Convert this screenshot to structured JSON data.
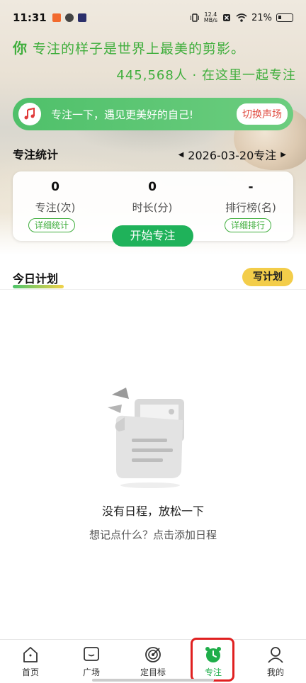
{
  "status_bar": {
    "time": "11:31",
    "net_speed_top": "12.4",
    "net_speed_bottom": "MB/s",
    "battery": "21%"
  },
  "header": {
    "motto_lead": "你",
    "motto_rest": " 专注的样子是世界上最美的剪影。",
    "online_text": "445,568人 · 在这里一起专注"
  },
  "banner": {
    "text": "专注一下，遇见更美好的自己!",
    "switch_label": "切换声场"
  },
  "stats": {
    "title": "专注统计",
    "date_label": "2026-03-20专注",
    "items": [
      {
        "value": "0",
        "label": "专注(次)"
      },
      {
        "value": "0",
        "label": "时长(分)"
      },
      {
        "value": "-",
        "label": "排行榜(名)"
      }
    ],
    "detail_stats_label": "详细统计",
    "detail_rank_label": "详细排行",
    "start_label": "开始专注"
  },
  "plan": {
    "title": "今日计划",
    "write_label": "写计划",
    "empty_title": "没有日程，放松一下",
    "empty_sub": "想记点什么？点击添加日程"
  },
  "nav": {
    "items": [
      {
        "label": "首页",
        "icon": "home-icon"
      },
      {
        "label": "广场",
        "icon": "square-chat-icon"
      },
      {
        "label": "定目标",
        "icon": "target-icon"
      },
      {
        "label": "专注",
        "icon": "alarm-clock-icon"
      },
      {
        "label": "我的",
        "icon": "person-icon"
      }
    ],
    "active_color": "#1fae4a"
  },
  "colors": {
    "accent_green": "#3fae3c",
    "button_green": "#1fb25a",
    "plan_yellow": "#f3cd4a",
    "switch_red": "#e04a3f"
  }
}
